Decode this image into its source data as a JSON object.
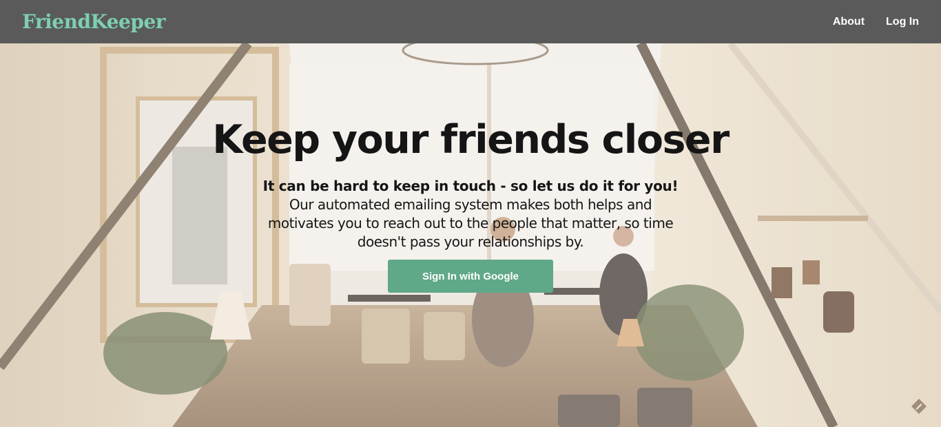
{
  "brand": {
    "name": "FriendKeeper",
    "color": "#7dcfb0"
  },
  "nav": {
    "about": "About",
    "login": "Log In"
  },
  "hero": {
    "title": "Keep your friends closer",
    "lead": "It can be hard to keep in touch - so let us do it for you!",
    "description": "Our automated emailing system makes both helps and motivates you to reach out to the people that matter, so time doesn't pass your relationships by.",
    "cta_label": "Sign In with Google",
    "cta_color": "#5fa888",
    "background_image": "cafe-interior-photo"
  },
  "corner_icon": "pencil-badge-icon"
}
